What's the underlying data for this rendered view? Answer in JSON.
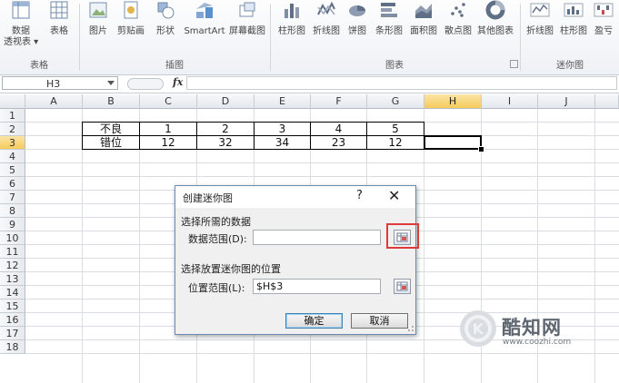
{
  "ribbon": {
    "buttons": [
      {
        "key": "pivot",
        "label": "数据\n透视表 ▾"
      },
      {
        "key": "table",
        "label": "表格"
      },
      {
        "key": "picture",
        "label": "图片"
      },
      {
        "key": "clipart",
        "label": "剪贴画"
      },
      {
        "key": "shapes",
        "label": "形状"
      },
      {
        "key": "smartart",
        "label": "SmartArt"
      },
      {
        "key": "screenshot",
        "label": "屏幕截图"
      },
      {
        "key": "column",
        "label": "柱形图"
      },
      {
        "key": "line",
        "label": "折线图"
      },
      {
        "key": "pie",
        "label": "饼图"
      },
      {
        "key": "bar",
        "label": "条形图"
      },
      {
        "key": "area",
        "label": "面积图"
      },
      {
        "key": "scatter",
        "label": "散点图"
      },
      {
        "key": "other",
        "label": "其他图表"
      },
      {
        "key": "spark-line",
        "label": "折线图"
      },
      {
        "key": "spark-column",
        "label": "柱形图"
      },
      {
        "key": "spark-winloss",
        "label": "盈亏"
      }
    ],
    "groups": {
      "tables": "表格",
      "illustrations": "插图",
      "charts": "图表",
      "sparklines": "迷你图"
    }
  },
  "formula_bar": {
    "name_box": "H3",
    "fx": "fx",
    "content": ""
  },
  "sheet": {
    "columns": [
      "A",
      "B",
      "C",
      "D",
      "E",
      "F",
      "G",
      "H",
      "I",
      "J"
    ],
    "rows": [
      "1",
      "2",
      "3",
      "4",
      "5",
      "6",
      "7",
      "8",
      "9",
      "10",
      "11",
      "12",
      "13",
      "14",
      "15",
      "16",
      "17",
      "18"
    ],
    "selected_column": "H",
    "selected_row": "3",
    "table": [
      [
        "不良",
        "1",
        "2",
        "3",
        "4",
        "5"
      ],
      [
        "错位",
        "12",
        "32",
        "34",
        "23",
        "12"
      ]
    ]
  },
  "dialog": {
    "title": "创建迷你图",
    "help": "?",
    "close": "✕",
    "section_data": "选择所需的数据",
    "data_range_label": "数据范围(D):",
    "data_range_value": "",
    "section_location": "选择放置迷你图的位置",
    "location_range_label": "位置范围(L):",
    "location_range_value": "$H$3",
    "ok": "确定",
    "cancel": "取消"
  },
  "watermark": {
    "name": "酷知网",
    "url": "www.coozhi.com"
  },
  "colors": {
    "selection_header": "#f5cb5c",
    "highlight": "#e03a3a",
    "dialog_border": "#6b8ab0"
  }
}
